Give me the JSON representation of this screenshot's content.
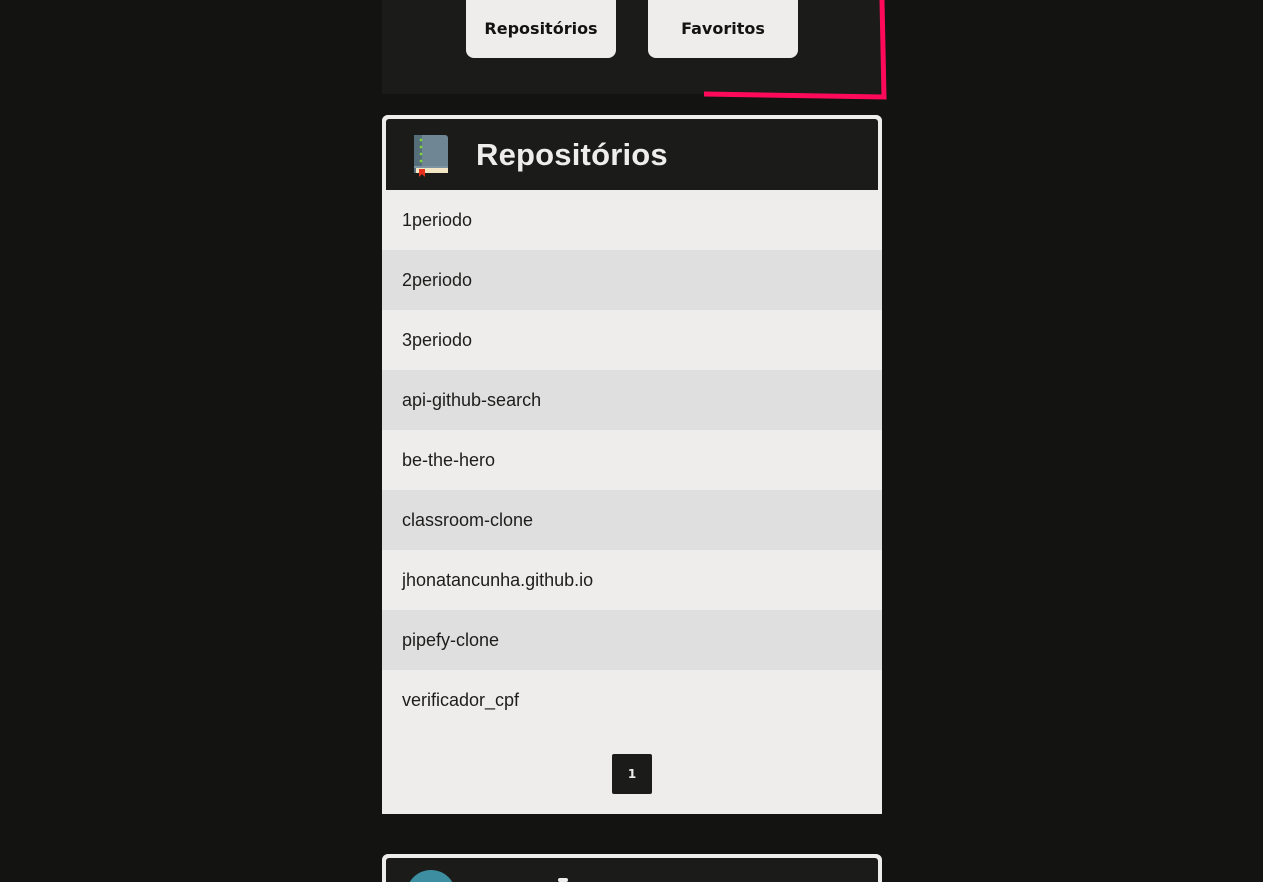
{
  "nav": {
    "repos_label": "Repositórios",
    "favorites_label": "Favoritos"
  },
  "colors": {
    "accent": "#ff0a5a",
    "card_dark": "#1b1c19",
    "background": "#131311",
    "row_light": "#eeedeb",
    "row_alt": "#dfdfdf"
  },
  "repositories": {
    "icon": "book-icon",
    "title": "Repositórios",
    "items": [
      "1periodo",
      "2periodo",
      "3periodo",
      "api-github-search",
      "be-the-hero",
      "classroom-clone",
      "jhonatancunha.github.io",
      "pipefy-clone",
      "verificador_cpf"
    ],
    "pagination": {
      "current_page": "1"
    }
  },
  "next_section": {
    "icon": "avatar"
  }
}
